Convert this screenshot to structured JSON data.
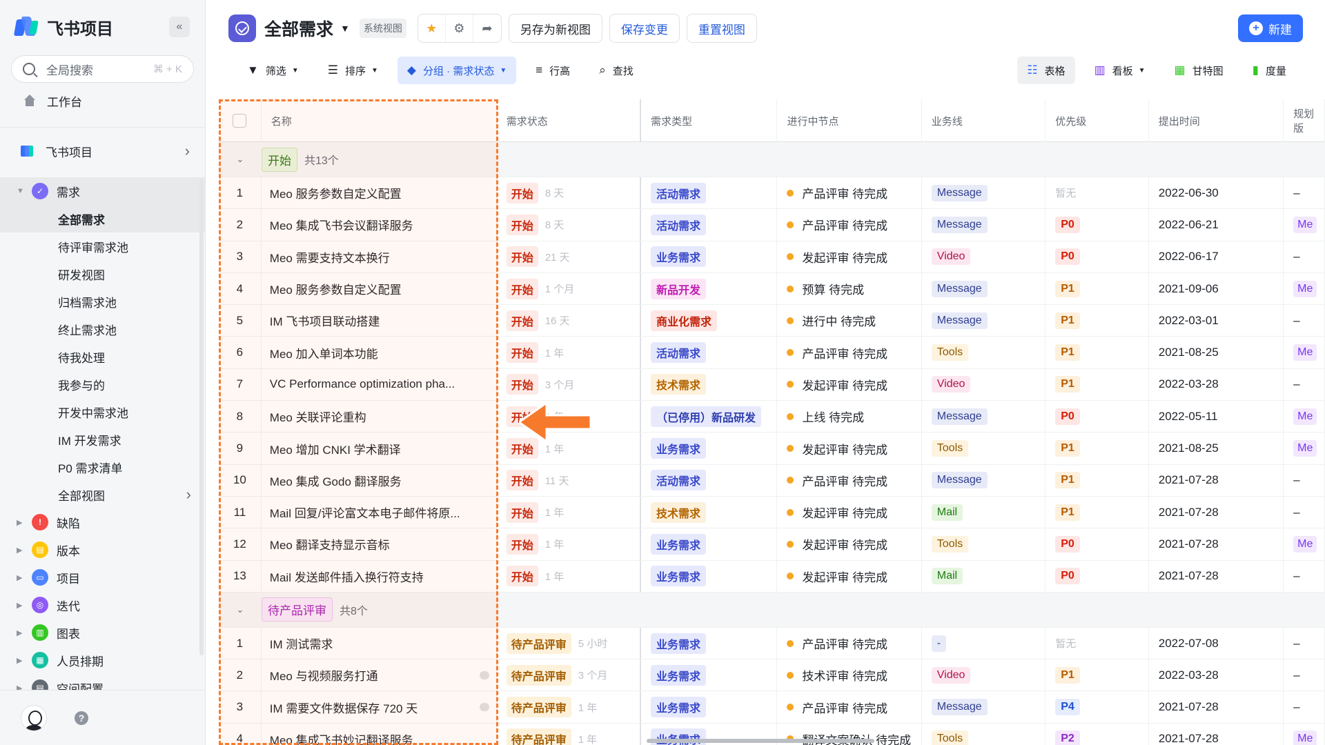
{
  "sidebar": {
    "title": "飞书项目",
    "collapse": "«",
    "search": {
      "placeholder": "全局搜索",
      "shortcut": "⌘ + K"
    },
    "home": "工作台",
    "project": "飞书项目",
    "tree": {
      "requirement": {
        "label": "需求",
        "color": "#7b6cf6"
      },
      "children": [
        "全部需求",
        "待评审需求池",
        "研发视图",
        "归档需求池",
        "终止需求池",
        "待我处理",
        "我参与的",
        "开发中需求池",
        "IM 开发需求",
        "P0 需求清单",
        "全部视图"
      ],
      "others": [
        {
          "label": "缺陷",
          "color": "#f54a45",
          "icon": "bug-icon"
        },
        {
          "label": "版本",
          "color": "#ffc60a",
          "icon": "version-icon"
        },
        {
          "label": "项目",
          "color": "#4e83fd",
          "icon": "folder-icon"
        },
        {
          "label": "迭代",
          "color": "#8f5bf5",
          "icon": "iteration-icon"
        },
        {
          "label": "图表",
          "color": "#34c724",
          "icon": "chart-icon"
        },
        {
          "label": "人员排期",
          "color": "#14c0a2",
          "icon": "schedule-icon"
        },
        {
          "label": "空间配置",
          "color": "#646a73",
          "icon": "config-icon"
        }
      ]
    }
  },
  "topbar": {
    "title": "全部需求",
    "badge": "系统视图",
    "save_as": "另存为新视图",
    "save_changes": "保存变更",
    "reset_view": "重置视图",
    "new": "新建"
  },
  "toolbar": {
    "filter": "筛选",
    "sort": "排序",
    "group": "分组 · 需求状态",
    "row_height": "行高",
    "find": "查找",
    "views": {
      "table": "表格",
      "board": "看板",
      "gantt": "甘特图",
      "metric": "度量"
    }
  },
  "table": {
    "headers": {
      "name": "名称",
      "status": "需求状态",
      "type": "需求类型",
      "node": "进行中节点",
      "biz": "业务线",
      "priority": "优先级",
      "date": "提出时间",
      "plan": "规划版"
    },
    "groups": [
      {
        "label": "开始",
        "count": "共13个",
        "tag_bg": "#eaf6e2",
        "tag_color": "#2c7c16",
        "tag_border": "#c8e6b5",
        "rows": [
          {
            "no": "1",
            "name": "Meo 服务参数自定义配置",
            "status": "开始",
            "dur": "8 天",
            "type": "活动需求",
            "node": "产品评审 待完成",
            "biz": "Message",
            "pri": "暂无",
            "date": "2022-06-30",
            "plan": "–"
          },
          {
            "no": "2",
            "name": "Meo 集成飞书会议翻译服务",
            "status": "开始",
            "dur": "8 天",
            "type": "活动需求",
            "node": "产品评审 待完成",
            "biz": "Message",
            "pri": "P0",
            "date": "2022-06-21",
            "plan": "Me"
          },
          {
            "no": "3",
            "name": "Meo 需要支持文本换行",
            "status": "开始",
            "dur": "21 天",
            "type": "业务需求",
            "node": "发起评审 待完成",
            "biz": "Video",
            "pri": "P0",
            "date": "2022-06-17",
            "plan": "–"
          },
          {
            "no": "4",
            "name": "Meo 服务参数自定义配置",
            "status": "开始",
            "dur": "1 个月",
            "type": "新品开发",
            "node": "预算 待完成",
            "biz": "Message",
            "pri": "P1",
            "date": "2021-09-06",
            "plan": "Me"
          },
          {
            "no": "5",
            "name": "IM 飞书项目联动搭建",
            "status": "开始",
            "dur": "16 天",
            "type": "商业化需求",
            "node": "进行中 待完成",
            "biz": "Message",
            "pri": "P1",
            "date": "2022-03-01",
            "plan": "–"
          },
          {
            "no": "6",
            "name": "Meo 加入单词本功能",
            "status": "开始",
            "dur": "1 年",
            "type": "活动需求",
            "node": "产品评审 待完成",
            "biz": "Tools",
            "pri": "P1",
            "date": "2021-08-25",
            "plan": "Me"
          },
          {
            "no": "7",
            "name": "VC Performance optimization pha...",
            "status": "开始",
            "dur": "3 个月",
            "type": "技术需求",
            "node": "发起评审 待完成",
            "biz": "Video",
            "pri": "P1",
            "date": "2022-03-28",
            "plan": "–"
          },
          {
            "no": "8",
            "name": "Meo 关联评论重构",
            "status": "开始",
            "dur": "1 年",
            "type": "（已停用）新品研发",
            "node": "上线 待完成",
            "biz": "Message",
            "pri": "P0",
            "date": "2022-05-11",
            "plan": "Me"
          },
          {
            "no": "9",
            "name": "Meo 增加 CNKI 学术翻译",
            "status": "开始",
            "dur": "1 年",
            "type": "业务需求",
            "node": "发起评审 待完成",
            "biz": "Tools",
            "pri": "P1",
            "date": "2021-08-25",
            "plan": "Me"
          },
          {
            "no": "10",
            "name": "Meo 集成 Godo 翻译服务",
            "status": "开始",
            "dur": "11 天",
            "type": "活动需求",
            "node": "产品评审 待完成",
            "biz": "Message",
            "pri": "P1",
            "date": "2021-07-28",
            "plan": "–"
          },
          {
            "no": "11",
            "name": "Mail 回复/评论富文本电子邮件将原...",
            "status": "开始",
            "dur": "1 年",
            "type": "技术需求",
            "node": "发起评审 待完成",
            "biz": "Mail",
            "pri": "P1",
            "date": "2021-07-28",
            "plan": "–"
          },
          {
            "no": "12",
            "name": "Meo 翻译支持显示音标",
            "status": "开始",
            "dur": "1 年",
            "type": "业务需求",
            "node": "发起评审 待完成",
            "biz": "Tools",
            "pri": "P0",
            "date": "2021-07-28",
            "plan": "Me"
          },
          {
            "no": "13",
            "name": "Mail 发送邮件插入换行符支持",
            "status": "开始",
            "dur": "1 年",
            "type": "业务需求",
            "node": "发起评审 待完成",
            "biz": "Mail",
            "pri": "P0",
            "date": "2021-07-28",
            "plan": "–"
          }
        ]
      },
      {
        "label": "待产品评审",
        "count": "共8个",
        "tag_bg": "#f8e9fb",
        "tag_color": "#a621b8",
        "tag_border": "#ecc3f2",
        "rows": [
          {
            "no": "1",
            "name": "IM 测试需求",
            "status": "待产品评审",
            "dur": "5 小时",
            "type": "业务需求",
            "node": "产品评审 待完成",
            "biz": "-",
            "pri": "暂无",
            "date": "2022-07-08",
            "plan": "–"
          },
          {
            "no": "2",
            "name": "Meo 与视频服务打通",
            "status": "待产品评审",
            "dur": "3 个月",
            "type": "业务需求",
            "node": "技术评审 待完成",
            "biz": "Video",
            "pri": "P1",
            "date": "2022-03-28",
            "plan": "–"
          },
          {
            "no": "3",
            "name": "IM 需要文件数据保存 720 天",
            "status": "待产品评审",
            "dur": "1 年",
            "type": "业务需求",
            "node": "产品评审 待完成",
            "biz": "Message",
            "pri": "P4",
            "date": "2021-07-28",
            "plan": "–"
          },
          {
            "no": "4",
            "name": "Meo 集成飞书妙记翻译服务",
            "status": "待产品评审",
            "dur": "1 年",
            "type": "业务需求",
            "node": "翻译文案确认 待完成",
            "biz": "Tools",
            "pri": "P2",
            "date": "2021-07-28",
            "plan": "Me"
          }
        ]
      }
    ]
  },
  "colors": {
    "type": {
      "活动需求": [
        "#e6e9fc",
        "#3a49c9"
      ],
      "业务需求": [
        "#e6e9fc",
        "#3a49c9"
      ],
      "新品开发": [
        "#fce4f7",
        "#c11db2"
      ],
      "商业化需求": [
        "#fde6e4",
        "#c2230b"
      ],
      "技术需求": [
        "#fdf0dc",
        "#b26400"
      ],
      "（已停用）新品研发": [
        "#e8eafc",
        "#2f3fae"
      ]
    },
    "biz": {
      "Message": [
        "#e7eaf7",
        "#2f3e8f"
      ],
      "Video": [
        "#fce6ef",
        "#b3124a"
      ],
      "Tools": [
        "#fdf3df",
        "#8f5b00"
      ],
      "Mail": [
        "#e5f5df",
        "#1f7a12"
      ],
      "-": [
        "#e7eaf7",
        "#2f3e8f"
      ]
    },
    "pri": {
      "P0": [
        "#fde6e4",
        "#d41d06"
      ],
      "P1": [
        "#fdf0dc",
        "#b65b00"
      ],
      "P2": [
        "#f4e6fc",
        "#8a2bc4"
      ],
      "P4": [
        "#e4ecfd",
        "#1f4fd1"
      ]
    },
    "status": {
      "开始": [
        "#fde9e5",
        "#c72a0e"
      ],
      "待产品评审": [
        "#fdf1da",
        "#a35d00"
      ]
    }
  }
}
